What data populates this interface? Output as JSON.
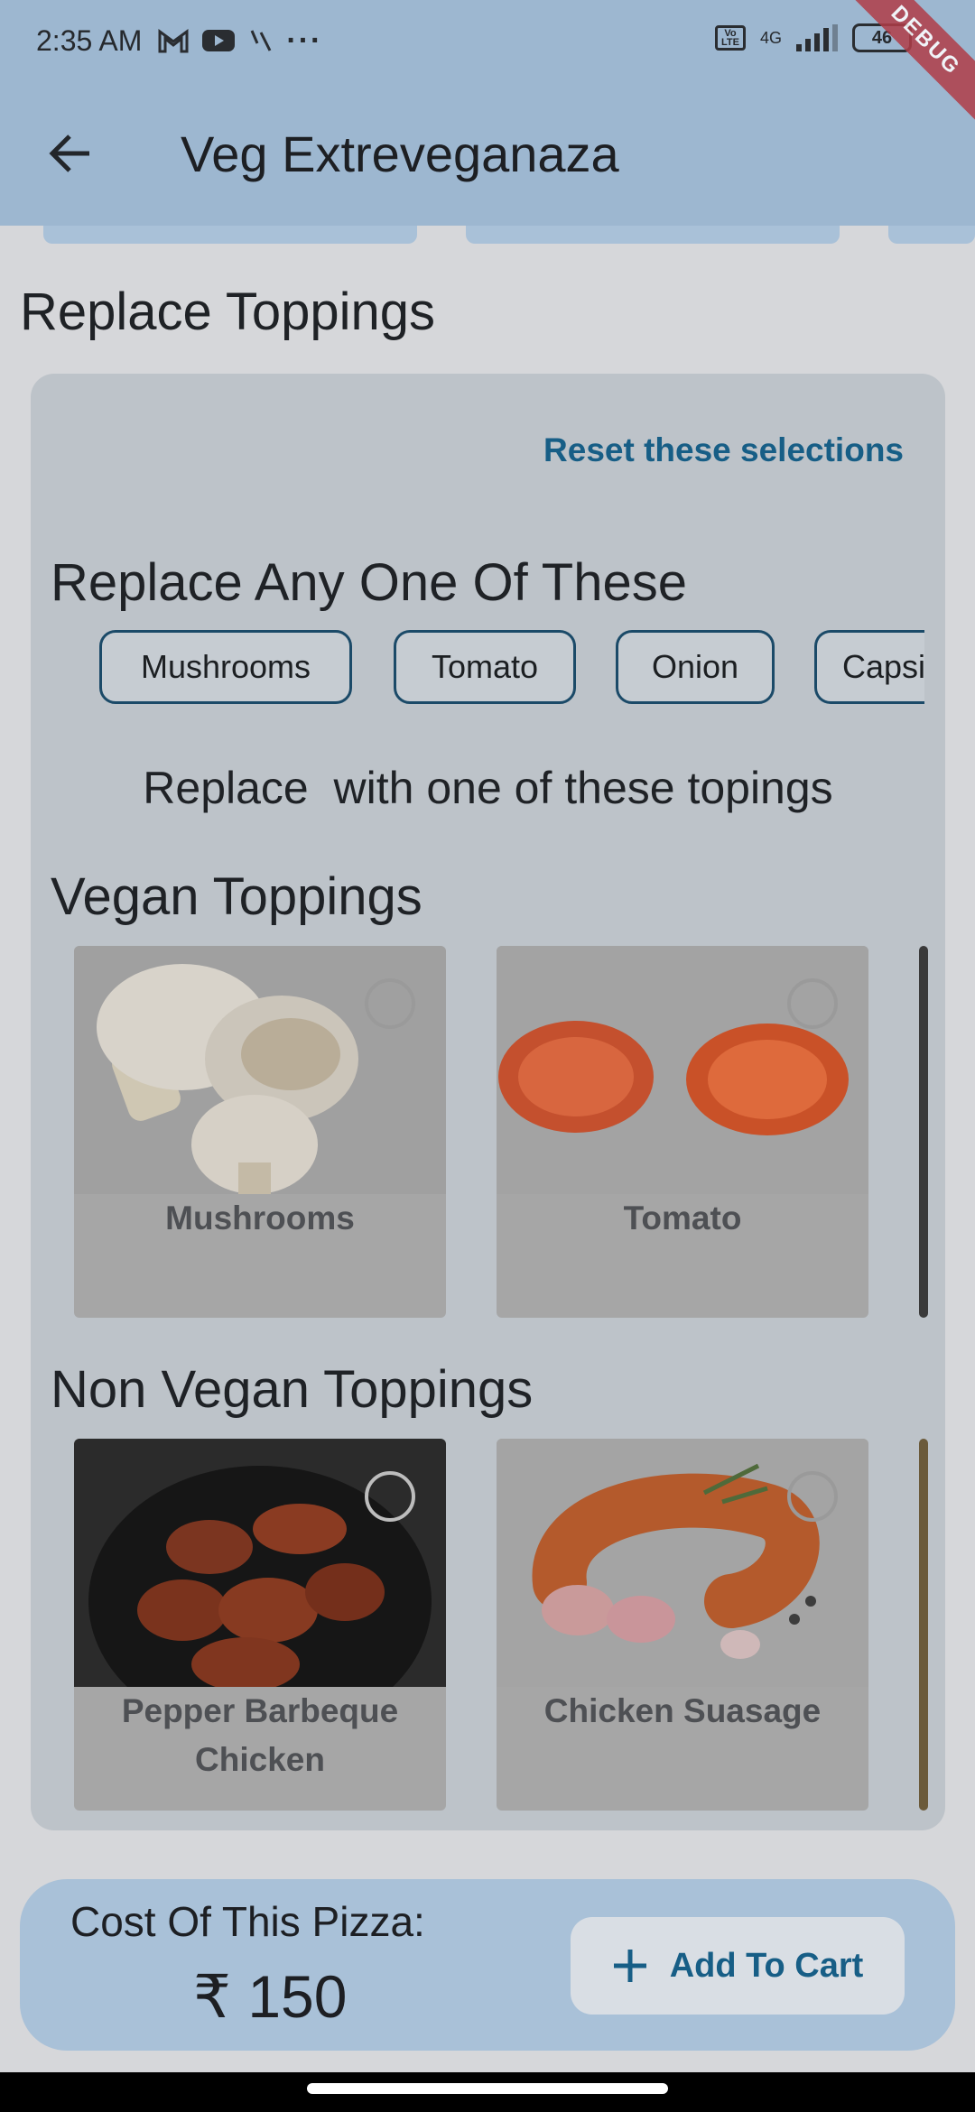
{
  "status_bar": {
    "time": "2:35 AM",
    "more": "···",
    "network": "4G",
    "battery": "46"
  },
  "debug_banner": "DEBUG",
  "app_bar": {
    "title": "Veg Extreveganaza",
    "back_icon": "arrow-left-icon"
  },
  "section": {
    "title": "Replace Toppings",
    "reset_label": "Reset these selections",
    "replace_any_title": "Replace Any One Of These",
    "current_toppings": [
      "Mushrooms",
      "Tomato",
      "Onion",
      "Capsic"
    ],
    "replace_with_text": "Replace  with one of these topings"
  },
  "vegan": {
    "title": "Vegan Toppings",
    "items": [
      {
        "label": "Mushrooms",
        "selected": false
      },
      {
        "label": "Tomato",
        "selected": false
      }
    ]
  },
  "non_vegan": {
    "title": "Non Vegan Toppings",
    "items": [
      {
        "label": "Pepper Barbeque Chicken",
        "selected": false
      },
      {
        "label": "Chicken Suasage",
        "selected": false
      }
    ]
  },
  "footer": {
    "cost_label": "Cost Of This Pizza:",
    "cost_value": "₹ 150",
    "add_to_cart_label": "Add To Cart",
    "add_icon": "plus-icon"
  },
  "colors": {
    "app_bar": "#9db7d0",
    "accent": "#175e86",
    "panel": "#bdc3c9"
  }
}
